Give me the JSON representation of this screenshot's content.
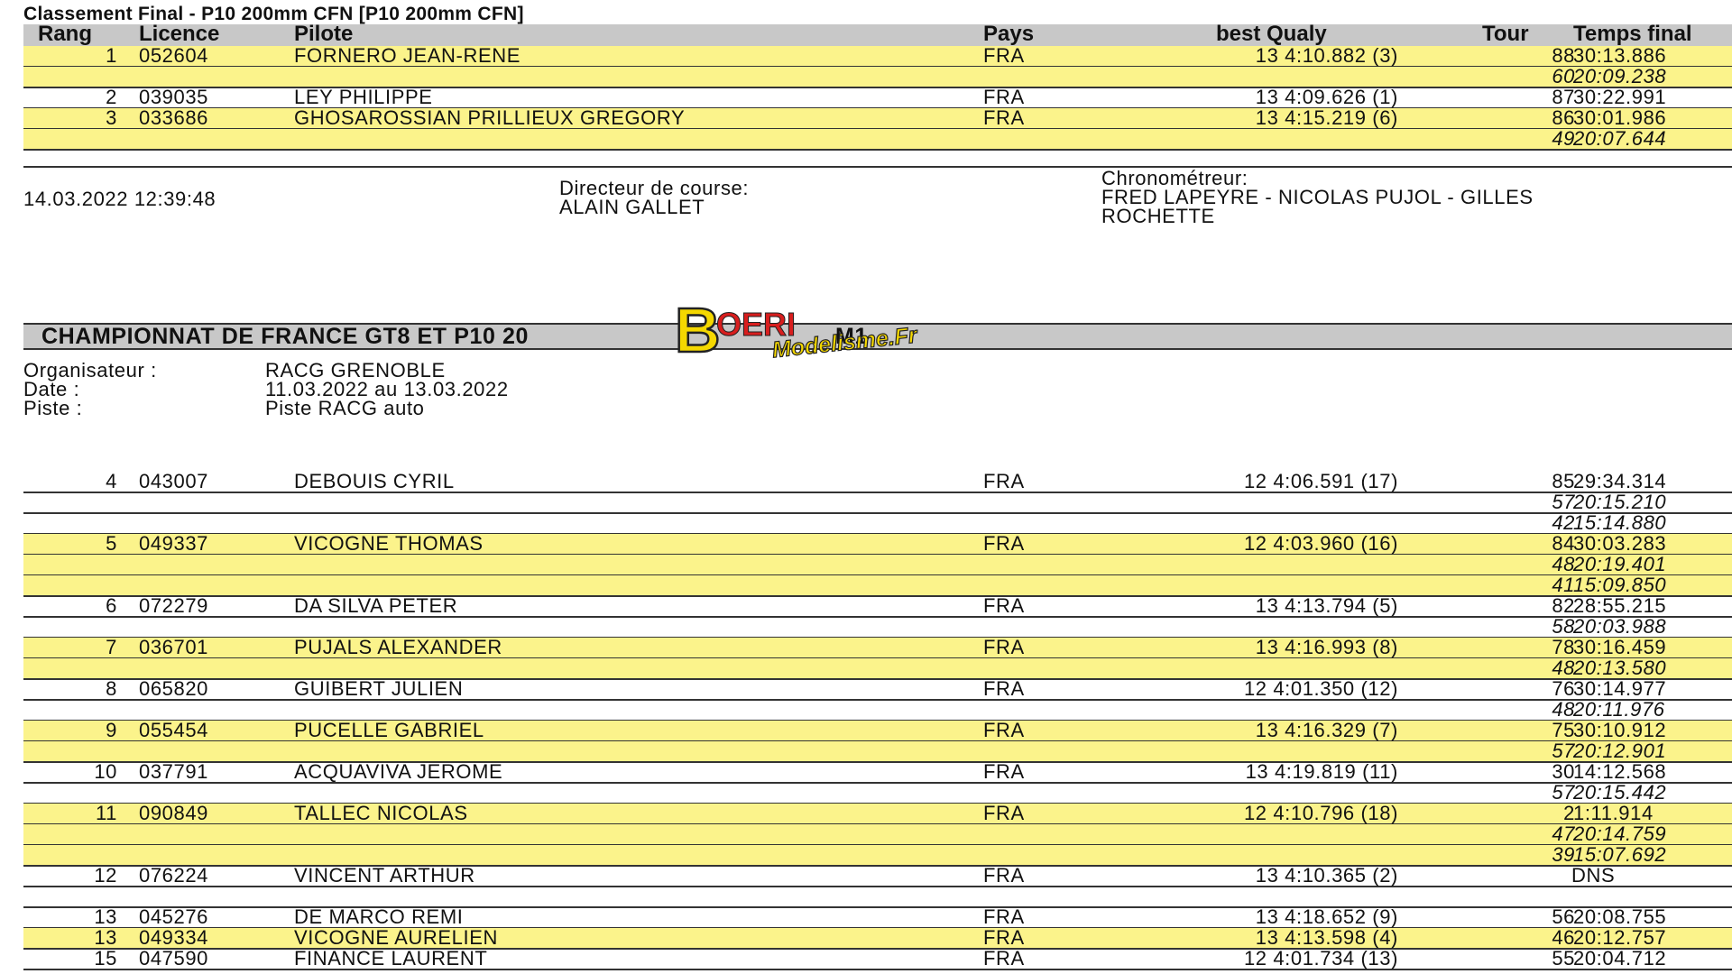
{
  "title": "Classement Final  -  P10 200mm CFN [P10 200mm CFN]",
  "columns": {
    "rang": "Rang",
    "licence": "Licence",
    "pilote": "Pilote",
    "pays": "Pays",
    "qualy": "best Qualy",
    "tour": "Tour",
    "temps": "Temps final"
  },
  "top_rows": [
    {
      "rang": "1",
      "licence": "052604",
      "pilote": "FORNERO JEAN-RENE",
      "pays": "FRA",
      "qualy": "13 4:10.882 (3)",
      "tour": "88",
      "temps": "30:13.886",
      "subs": [
        {
          "tour": "60",
          "temps": "20:09.238"
        }
      ]
    },
    {
      "rang": "2",
      "licence": "039035",
      "pilote": "LEY PHILIPPE",
      "pays": "FRA",
      "qualy": "13 4:09.626 (1)",
      "tour": "87",
      "temps": "30:22.991",
      "subs": []
    },
    {
      "rang": "3",
      "licence": "033686",
      "pilote": "GHOSAROSSIAN PRILLIEUX GREGORY",
      "pays": "FRA",
      "qualy": "13 4:15.219 (6)",
      "tour": "86",
      "temps": "30:01.986",
      "subs": [
        {
          "tour": "49",
          "temps": "20:07.644"
        }
      ]
    }
  ],
  "footer": {
    "datetime": "14.03.2022 12:39:48",
    "directeur_label": "Directeur de course:",
    "directeur": "ALAIN GALLET",
    "chrono_label": "Chronométreur:",
    "chrono_line1": "FRED LAPEYRE - NICOLAS PUJOL - GILLES",
    "chrono_line2": "ROCHETTE"
  },
  "event": {
    "banner": "CHAMPIONNAT DE FRANCE GT8 ET P10 20",
    "banner_tail": "M1",
    "organisateur_label": "Organisateur :",
    "organisateur": "RACG GRENOBLE",
    "date_label": "Date :",
    "date": "11.03.2022 au 13.03.2022",
    "piste_label": "Piste :",
    "piste": "Piste RACG auto"
  },
  "logo": {
    "line1": "BOERI",
    "line2": "Modelisme.Fr",
    "colors": {
      "yellow": "#f5d800",
      "red": "#d81e1e"
    }
  },
  "bottom_rows": [
    {
      "rang": "4",
      "licence": "043007",
      "pilote": "DEBOUIS CYRIL",
      "pays": "FRA",
      "qualy": "12 4:06.591 (17)",
      "tour": "85",
      "temps": "29:34.314",
      "yellow": false,
      "subs": [
        {
          "tour": "57",
          "temps": "20:15.210"
        },
        {
          "tour": "42",
          "temps": "15:14.880"
        }
      ]
    },
    {
      "rang": "5",
      "licence": "049337",
      "pilote": "VICOGNE THOMAS",
      "pays": "FRA",
      "qualy": "12 4:03.960 (16)",
      "tour": "84",
      "temps": "30:03.283",
      "yellow": true,
      "subs": [
        {
          "tour": "48",
          "temps": "20:19.401"
        },
        {
          "tour": "41",
          "temps": "15:09.850"
        }
      ]
    },
    {
      "rang": "6",
      "licence": "072279",
      "pilote": "DA SILVA PETER",
      "pays": "FRA",
      "qualy": "13 4:13.794 (5)",
      "tour": "82",
      "temps": "28:55.215",
      "yellow": false,
      "subs": [
        {
          "tour": "58",
          "temps": "20:03.988"
        }
      ]
    },
    {
      "rang": "7",
      "licence": "036701",
      "pilote": "PUJALS ALEXANDER",
      "pays": "FRA",
      "qualy": "13 4:16.993 (8)",
      "tour": "78",
      "temps": "30:16.459",
      "yellow": true,
      "subs": [
        {
          "tour": "48",
          "temps": "20:13.580"
        }
      ]
    },
    {
      "rang": "8",
      "licence": "065820",
      "pilote": "GUIBERT JULIEN",
      "pays": "FRA",
      "qualy": "12 4:01.350 (12)",
      "tour": "76",
      "temps": "30:14.977",
      "yellow": false,
      "subs": [
        {
          "tour": "48",
          "temps": "20:11.976"
        }
      ]
    },
    {
      "rang": "9",
      "licence": "055454",
      "pilote": "PUCELLE GABRIEL",
      "pays": "FRA",
      "qualy": "13 4:16.329 (7)",
      "tour": "75",
      "temps": "30:10.912",
      "yellow": true,
      "subs": [
        {
          "tour": "57",
          "temps": "20:12.901"
        }
      ]
    },
    {
      "rang": "10",
      "licence": "037791",
      "pilote": "ACQUAVIVA JEROME",
      "pays": "FRA",
      "qualy": "13 4:19.819 (11)",
      "tour": "30",
      "temps": "14:12.568",
      "yellow": false,
      "subs": [
        {
          "tour": "57",
          "temps": "20:15.442"
        }
      ]
    },
    {
      "rang": "11",
      "licence": "090849",
      "pilote": "TALLEC NICOLAS",
      "pays": "FRA",
      "qualy": "12 4:10.796 (18)",
      "tour": "2",
      "temps": "1:11.914",
      "yellow": true,
      "subs": [
        {
          "tour": "47",
          "temps": "20:14.759"
        },
        {
          "tour": "39",
          "temps": "15:07.692"
        }
      ]
    },
    {
      "rang": "12",
      "licence": "076224",
      "pilote": "VINCENT ARTHUR",
      "pays": "FRA",
      "qualy": "13 4:10.365 (2)",
      "tour": "",
      "temps": "DNS",
      "yellow": false,
      "subs": [
        {
          "tour": "",
          "temps": ""
        }
      ]
    },
    {
      "rang": "13",
      "licence": "045276",
      "pilote": "DE MARCO REMI",
      "pays": "FRA",
      "qualy": "13 4:18.652 (9)",
      "tour": "56",
      "temps": "20:08.755",
      "yellow": false,
      "subs": []
    },
    {
      "rang": "13",
      "licence": "049334",
      "pilote": "VICOGNE AURELIEN",
      "pays": "FRA",
      "qualy": "13 4:13.598 (4)",
      "tour": "46",
      "temps": "20:12.757",
      "yellow": true,
      "subs": []
    },
    {
      "rang": "15",
      "licence": "047590",
      "pilote": "FINANCE LAURENT",
      "pays": "FRA",
      "qualy": "12 4:01.734 (13)",
      "tour": "55",
      "temps": "20:04.712",
      "yellow": false,
      "subs": []
    }
  ]
}
